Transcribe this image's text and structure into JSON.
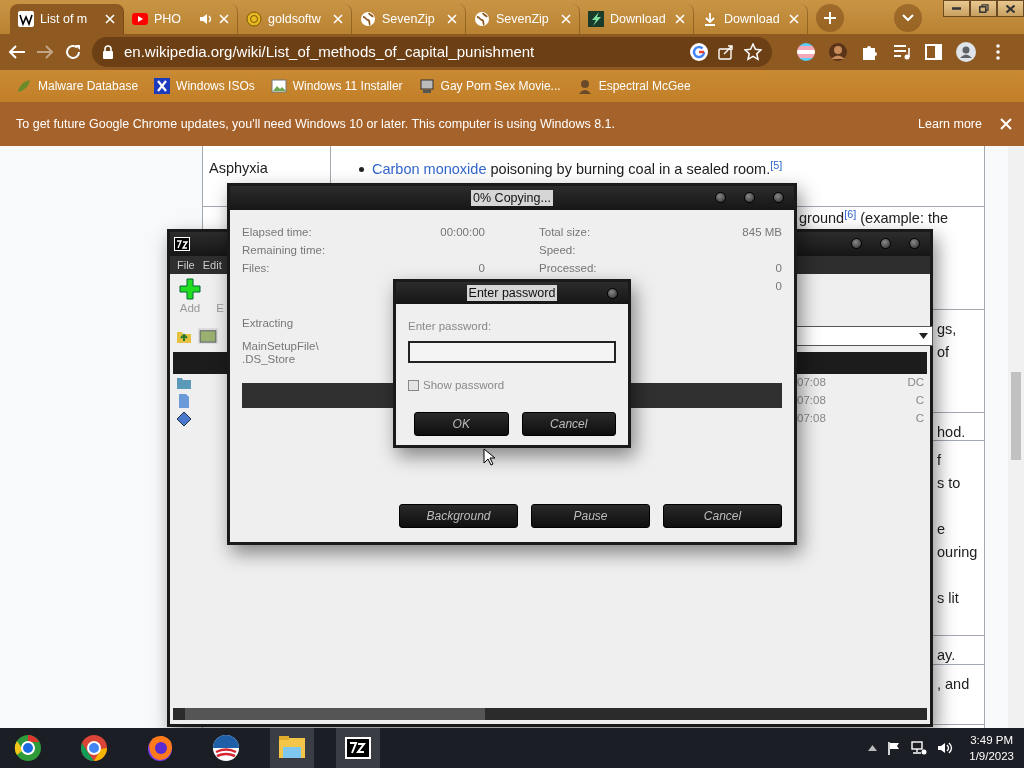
{
  "browser": {
    "tabs": [
      {
        "title": "List of m",
        "selected": true,
        "audio": false
      },
      {
        "title": "PHO",
        "selected": false,
        "audio": true
      },
      {
        "title": "goldsoftw",
        "selected": false,
        "audio": false
      },
      {
        "title": "SevenZip",
        "selected": false,
        "audio": false
      },
      {
        "title": "SevenZip",
        "selected": false,
        "audio": false
      },
      {
        "title": "Download",
        "selected": false,
        "audio": false
      },
      {
        "title": "Download",
        "selected": false,
        "audio": false
      }
    ],
    "forward_disabled": true,
    "address": "en.wikipedia.org/wiki/List_of_methods_of_capital_punishment",
    "bookmarks": [
      "Malware Database",
      "Windows ISOs",
      "Windows 11 Installer",
      "Gay Porn Sex Movie...",
      "Espectral McGee"
    ],
    "infobar": {
      "message": "To get future Google Chrome updates, you'll need Windows 10 or later. This computer is using Windows 8.1.",
      "link": "Learn more"
    }
  },
  "article": {
    "rows": [
      {
        "method": "Asphyxia",
        "items": [
          {
            "link": "Carbon monoxide",
            "text": " poisoning by burning coal in a sealed room.$^{[5]}$"
          }
        ]
      },
      {
        "paragraphs": [
          [
            "ground$^{[6]}$ (example: the"
          ]
        ]
      },
      {
        "paragraphs": [
          [
            "gs,",
            "of"
          ]
        ]
      },
      {
        "paragraphs": [
          [
            "hod."
          ]
        ]
      },
      {
        "paragraphs": [
          [
            "f",
            "s to"
          ],
          [
            "e",
            "ouring"
          ],
          [
            "s lit"
          ]
        ]
      },
      {
        "paragraphs": [
          [
            "ay."
          ]
        ]
      },
      {
        "paragraphs": [
          [
            ", and"
          ]
        ]
      }
    ]
  },
  "archive_manager": {
    "menu": [
      "File",
      "Edit"
    ],
    "toolbar": [
      "Add",
      "E"
    ],
    "files": [
      {
        "modified": "07:08",
        "attributes": "DC"
      },
      {
        "modified": "07:08",
        "attributes": "C"
      },
      {
        "modified": "07:08",
        "attributes": "C"
      }
    ]
  },
  "progress": {
    "title": "0% Copying...",
    "stats_left": [
      {
        "label": "Elapsed time:",
        "value": "00:00:00"
      },
      {
        "label": "Remaining time:"
      },
      {
        "label": "Files:",
        "value": "0"
      }
    ],
    "stats_right": [
      {
        "label": "Total size:",
        "value": "845 MB"
      },
      {
        "label": "Speed:"
      },
      {
        "label": "Processed:",
        "value": "0"
      },
      {
        "value": "0"
      }
    ],
    "operation": "Extracting",
    "path": "MainSetupFile\\",
    "file": ".DS_Store",
    "level": 0,
    "buttons": [
      "Background",
      "Pause",
      "Cancel"
    ]
  },
  "password_dialog": {
    "title": "Enter password",
    "label": "Enter password:",
    "show_password": {
      "label": "Show password",
      "checked": false
    },
    "buttons": [
      "OK",
      "Cancel"
    ]
  },
  "taskbar": {
    "apps": [
      {
        "running": false
      },
      {
        "running": false
      },
      {
        "running": false
      },
      {
        "running": false
      },
      {
        "running": true
      },
      {
        "running": true
      }
    ],
    "time": "3:49 PM",
    "date": "1/9/2023"
  }
}
